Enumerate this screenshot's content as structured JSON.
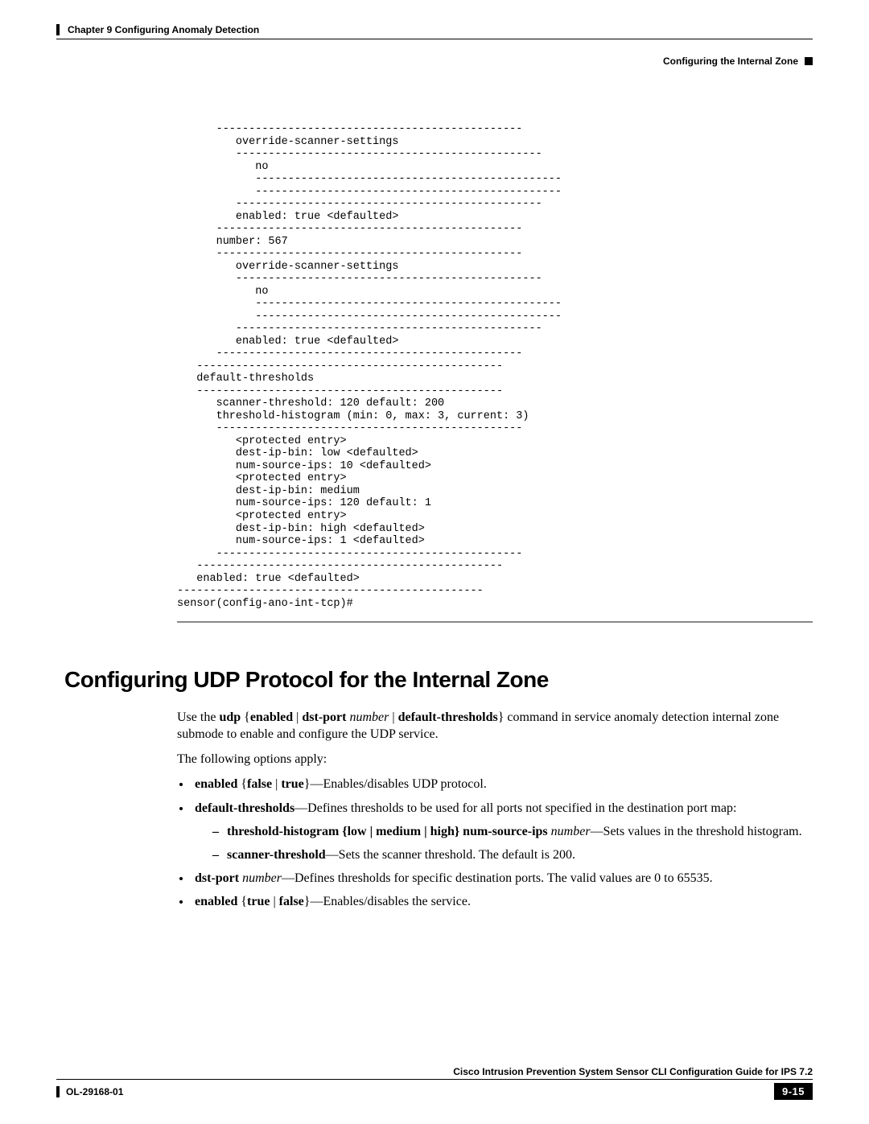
{
  "header": {
    "chapter": "Chapter 9      Configuring Anomaly Detection",
    "section": "Configuring the Internal Zone"
  },
  "config_block": "      -----------------------------------------------\n         override-scanner-settings\n         -----------------------------------------------\n            no\n            -----------------------------------------------\n            -----------------------------------------------\n         -----------------------------------------------\n         enabled: true <defaulted>\n      -----------------------------------------------\n      number: 567\n      -----------------------------------------------\n         override-scanner-settings\n         -----------------------------------------------\n            no\n            -----------------------------------------------\n            -----------------------------------------------\n         -----------------------------------------------\n         enabled: true <defaulted>\n      -----------------------------------------------\n   -----------------------------------------------\n   default-thresholds\n   -----------------------------------------------\n      scanner-threshold: 120 default: 200\n      threshold-histogram (min: 0, max: 3, current: 3)\n      -----------------------------------------------\n         <protected entry>\n         dest-ip-bin: low <defaulted>\n         num-source-ips: 10 <defaulted>\n         <protected entry>\n         dest-ip-bin: medium\n         num-source-ips: 120 default: 1\n         <protected entry>\n         dest-ip-bin: high <defaulted>\n         num-source-ips: 1 <defaulted>\n      -----------------------------------------------\n   -----------------------------------------------\n   enabled: true <defaulted>\n-----------------------------------------------\nsensor(config-ano-int-tcp)# ",
  "section_title": "Configuring UDP Protocol for the Internal Zone",
  "intro": {
    "p1a": "Use the ",
    "cmd_udp": "udp",
    "p1b": " {",
    "cmd_enabled": "enabled",
    "sep": " | ",
    "cmd_dstport": "dst-port",
    "space": " ",
    "arg_number": "number",
    "cmd_defthresh": "default-thresholds",
    "p1c": "} command in service anomaly detection internal zone submode to enable and configure the UDP service.",
    "p2": "The following options apply:"
  },
  "opts": {
    "o1_b": "enabled",
    "o1_mid1": " {",
    "o1_false": "false",
    "o1_true": "true",
    "o1_mid2": "}—Enables/disables UDP protocol.",
    "o2_b": "default-thresholds",
    "o2_txt": "—Defines thresholds to be used for all ports not specified in the destination port map:",
    "o2s1_b": "threshold-histogram {low | medium | high} num-source-ips",
    "o2s1_i": "number",
    "o2s1_txt": "—Sets values in the threshold histogram.",
    "o2s2_b": "scanner-threshold",
    "o2s2_txt": "—Sets the scanner threshold. The default is 200.",
    "o3_b": "dst-port",
    "o3_i": "number",
    "o3_txt": "—Defines thresholds for specific destination ports. The valid values are 0 to 65535.",
    "o4_b": "enabled",
    "o4_mid1": " {",
    "o4_true": "true",
    "o4_false": "false",
    "o4_mid2": "}—Enables/disables the service."
  },
  "footer": {
    "guide": "Cisco Intrusion Prevention System Sensor CLI Configuration Guide for IPS 7.2",
    "docid": "OL-29168-01",
    "page": "9-15"
  }
}
